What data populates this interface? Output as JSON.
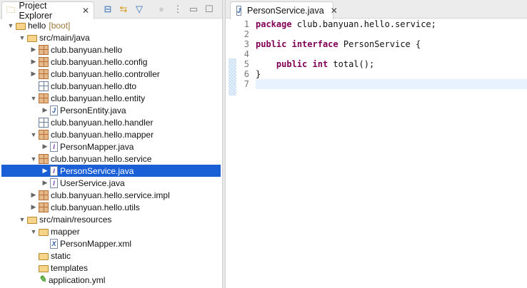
{
  "explorer": {
    "tab_label": "Project Explorer",
    "close_glyph": "✕",
    "tools": [
      {
        "name": "collapse-all-icon",
        "glyph": "⊟"
      },
      {
        "name": "link-editor-icon",
        "glyph": "⇆"
      },
      {
        "name": "filter-icon",
        "glyph": "▽"
      },
      {
        "name": "focus-icon",
        "glyph": "●"
      },
      {
        "name": "view-menu-icon",
        "glyph": "⋮"
      },
      {
        "name": "minimize-icon",
        "glyph": "▭"
      },
      {
        "name": "maximize-icon",
        "glyph": "☐"
      }
    ],
    "tree": [
      {
        "label": "hello",
        "suffix": "[boot]",
        "depth": 0,
        "arrow": "open",
        "icon": "project"
      },
      {
        "label": "src/main/java",
        "depth": 1,
        "arrow": "open",
        "icon": "srcfolder"
      },
      {
        "label": "club.banyuan.hello",
        "depth": 2,
        "arrow": "closed",
        "icon": "package"
      },
      {
        "label": "club.banyuan.hello.config",
        "depth": 2,
        "arrow": "closed",
        "icon": "package"
      },
      {
        "label": "club.banyuan.hello.controller",
        "depth": 2,
        "arrow": "closed",
        "icon": "package"
      },
      {
        "label": "club.banyuan.hello.dto",
        "depth": 2,
        "arrow": "none",
        "icon": "package-empty"
      },
      {
        "label": "club.banyuan.hello.entity",
        "depth": 2,
        "arrow": "open",
        "icon": "package"
      },
      {
        "label": "PersonEntity.java",
        "depth": 3,
        "arrow": "closed",
        "icon": "java"
      },
      {
        "label": "club.banyuan.hello.handler",
        "depth": 2,
        "arrow": "none",
        "icon": "package-empty"
      },
      {
        "label": "club.banyuan.hello.mapper",
        "depth": 2,
        "arrow": "open",
        "icon": "package"
      },
      {
        "label": "PersonMapper.java",
        "depth": 3,
        "arrow": "closed",
        "icon": "interface"
      },
      {
        "label": "club.banyuan.hello.service",
        "depth": 2,
        "arrow": "open",
        "icon": "package"
      },
      {
        "label": "PersonService.java",
        "depth": 3,
        "arrow": "closed",
        "icon": "interface",
        "selected": true
      },
      {
        "label": "UserService.java",
        "depth": 3,
        "arrow": "closed",
        "icon": "interface"
      },
      {
        "label": "club.banyuan.hello.service.impl",
        "depth": 2,
        "arrow": "closed",
        "icon": "package"
      },
      {
        "label": "club.banyuan.hello.utils",
        "depth": 2,
        "arrow": "closed",
        "icon": "package"
      },
      {
        "label": "src/main/resources",
        "depth": 1,
        "arrow": "open",
        "icon": "srcfolder"
      },
      {
        "label": "mapper",
        "depth": 2,
        "arrow": "open",
        "icon": "folder"
      },
      {
        "label": "PersonMapper.xml",
        "depth": 3,
        "arrow": "none",
        "icon": "xml"
      },
      {
        "label": "static",
        "depth": 2,
        "arrow": "none",
        "icon": "folder"
      },
      {
        "label": "templates",
        "depth": 2,
        "arrow": "none",
        "icon": "folder"
      },
      {
        "label": "application.yml",
        "depth": 2,
        "arrow": "none",
        "icon": "yml"
      }
    ]
  },
  "editor": {
    "tab_label": "PersonService.java",
    "close_glyph": "✕",
    "lines": [
      [
        {
          "t": "package",
          "k": 1
        },
        {
          "t": " club.banyuan.hello.service;"
        }
      ],
      [],
      [
        {
          "t": "public",
          "k": 1
        },
        {
          "t": " "
        },
        {
          "t": "interface",
          "k": 1
        },
        {
          "t": " PersonService {"
        }
      ],
      [],
      [
        {
          "t": "    "
        },
        {
          "t": "public",
          "k": 1
        },
        {
          "t": " "
        },
        {
          "t": "int",
          "k": 1
        },
        {
          "t": " total();"
        }
      ],
      [
        {
          "t": "}"
        }
      ],
      []
    ],
    "current_line": 7
  }
}
